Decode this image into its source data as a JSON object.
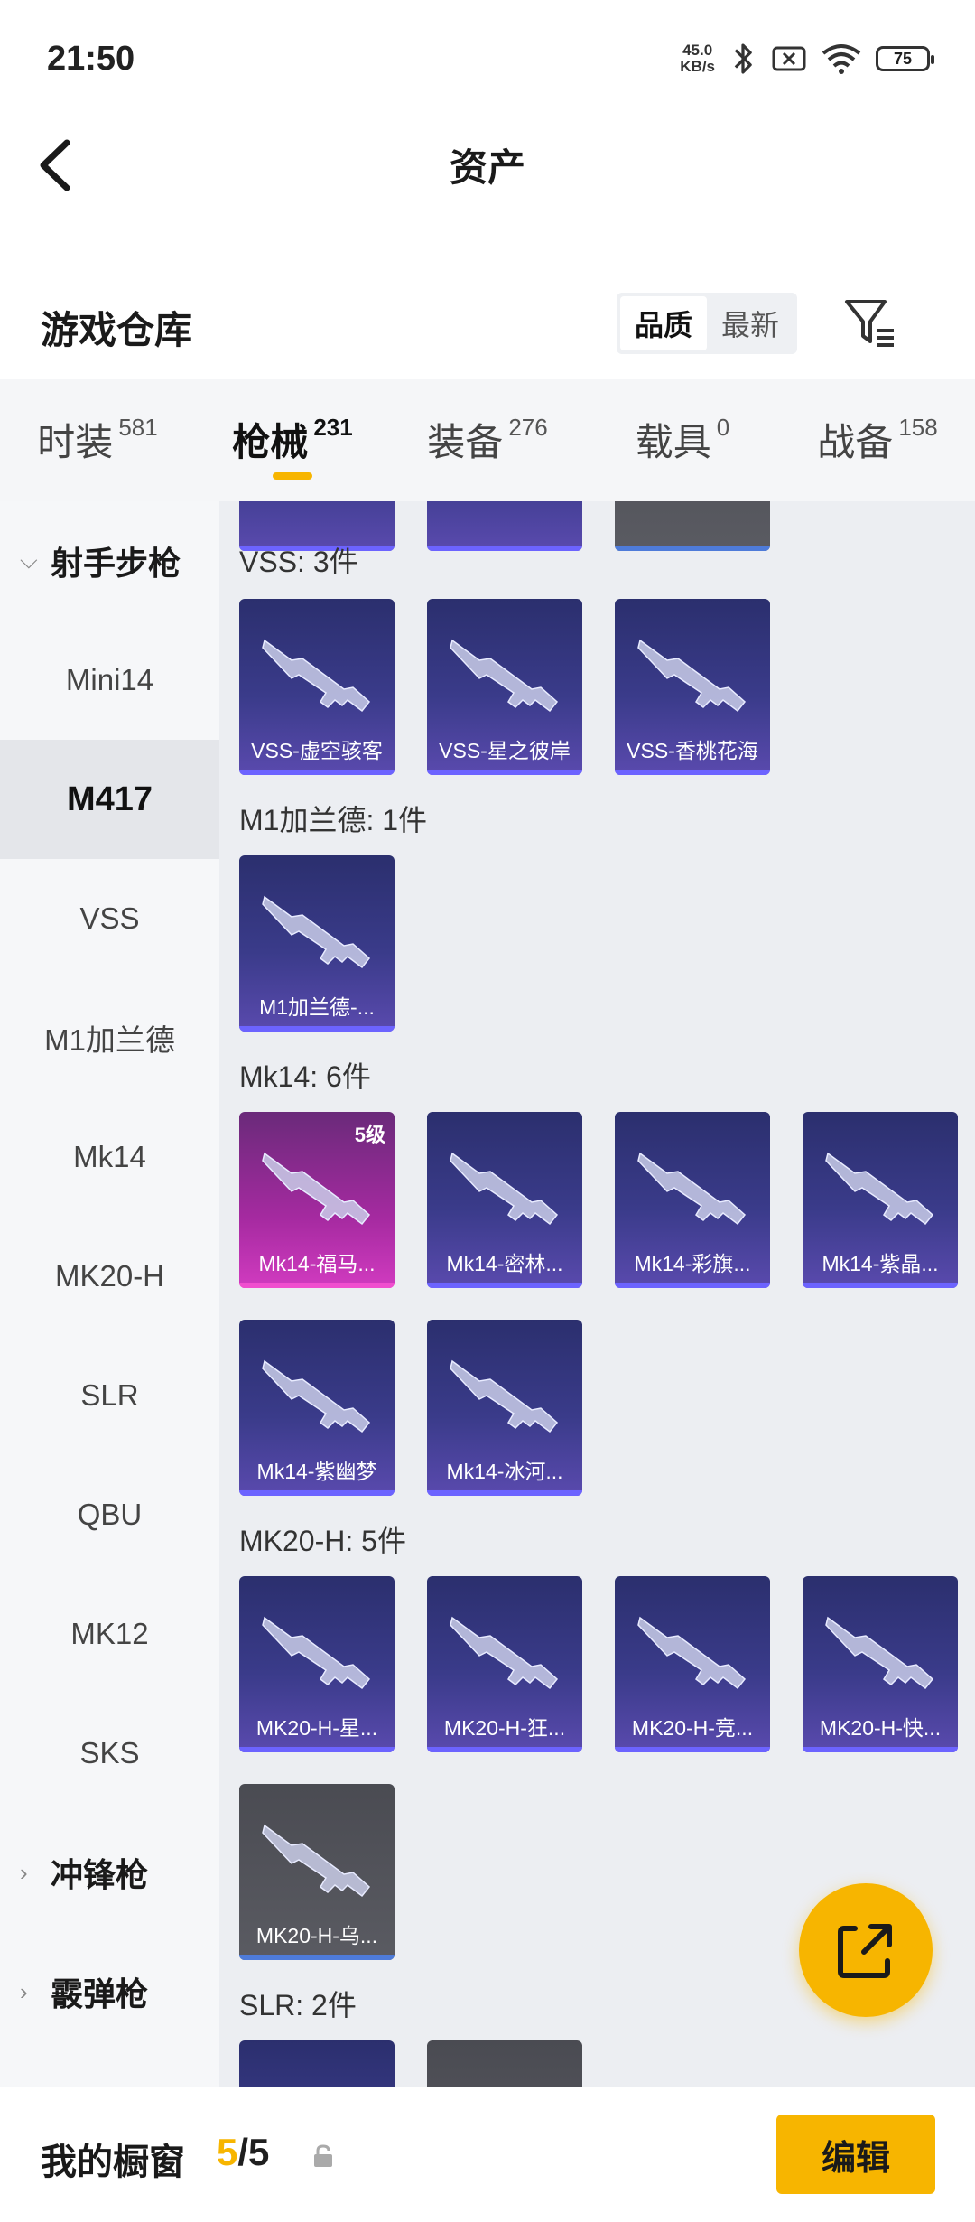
{
  "status_bar": {
    "time": "21:50",
    "net_speed_value": "45.0",
    "net_speed_unit": "KB/s",
    "battery": "75"
  },
  "header": {
    "title": "资产"
  },
  "section": {
    "title": "游戏仓库",
    "sort_options": [
      "品质",
      "最新"
    ],
    "active_sort": "品质"
  },
  "tabs": [
    {
      "label": "时装",
      "count": "581"
    },
    {
      "label": "枪械",
      "count": "231"
    },
    {
      "label": "装备",
      "count": "276"
    },
    {
      "label": "载具",
      "count": "0"
    },
    {
      "label": "战备",
      "count": "158"
    }
  ],
  "active_tab": "枪械",
  "sidebar": {
    "group_open": "射手步枪",
    "items": [
      "Mini14",
      "M417",
      "VSS",
      "M1加兰德",
      "Mk14",
      "MK20-H",
      "SLR",
      "QBU",
      "MK12",
      "SKS"
    ],
    "active_item": "M417",
    "groups_closed": [
      "冲锋枪",
      "霰弹枪"
    ]
  },
  "content": {
    "groups": [
      {
        "label": "VSS: 3件",
        "cards": [
          {
            "name": "VSS-虚空骇客",
            "rarity": "purple"
          },
          {
            "name": "VSS-星之彼岸",
            "rarity": "purple"
          },
          {
            "name": "VSS-香桃花海",
            "rarity": "purple"
          }
        ]
      },
      {
        "label": "M1加兰德: 1件",
        "cards": [
          {
            "name": "M1加兰德-...",
            "rarity": "purple"
          }
        ]
      },
      {
        "label": "Mk14: 6件",
        "cards": [
          {
            "name": "Mk14-福马...",
            "rarity": "gold",
            "level": "5级"
          },
          {
            "name": "Mk14-密林...",
            "rarity": "purple"
          },
          {
            "name": "Mk14-彩旗...",
            "rarity": "purple"
          },
          {
            "name": "Mk14-紫晶...",
            "rarity": "purple"
          },
          {
            "name": "Mk14-紫幽梦",
            "rarity": "purple"
          },
          {
            "name": "Mk14-冰河...",
            "rarity": "purple"
          }
        ]
      },
      {
        "label": "MK20-H: 5件",
        "cards": [
          {
            "name": "MK20-H-星...",
            "rarity": "purple"
          },
          {
            "name": "MK20-H-狂...",
            "rarity": "purple"
          },
          {
            "name": "MK20-H-竞...",
            "rarity": "purple"
          },
          {
            "name": "MK20-H-快...",
            "rarity": "purple"
          },
          {
            "name": "MK20-H-乌...",
            "rarity": "grey"
          }
        ]
      },
      {
        "label": "SLR: 2件",
        "cards": []
      }
    ]
  },
  "bottom": {
    "showcase_label": "我的橱窗",
    "showcase_current": "5",
    "showcase_sep": "/",
    "showcase_total": "5",
    "edit_label": "编辑"
  },
  "colors": {
    "accent": "#f7b500",
    "card_purple": "#3a3b8a",
    "card_gold": "#a52aa0",
    "card_grey": "#5a5b62"
  }
}
